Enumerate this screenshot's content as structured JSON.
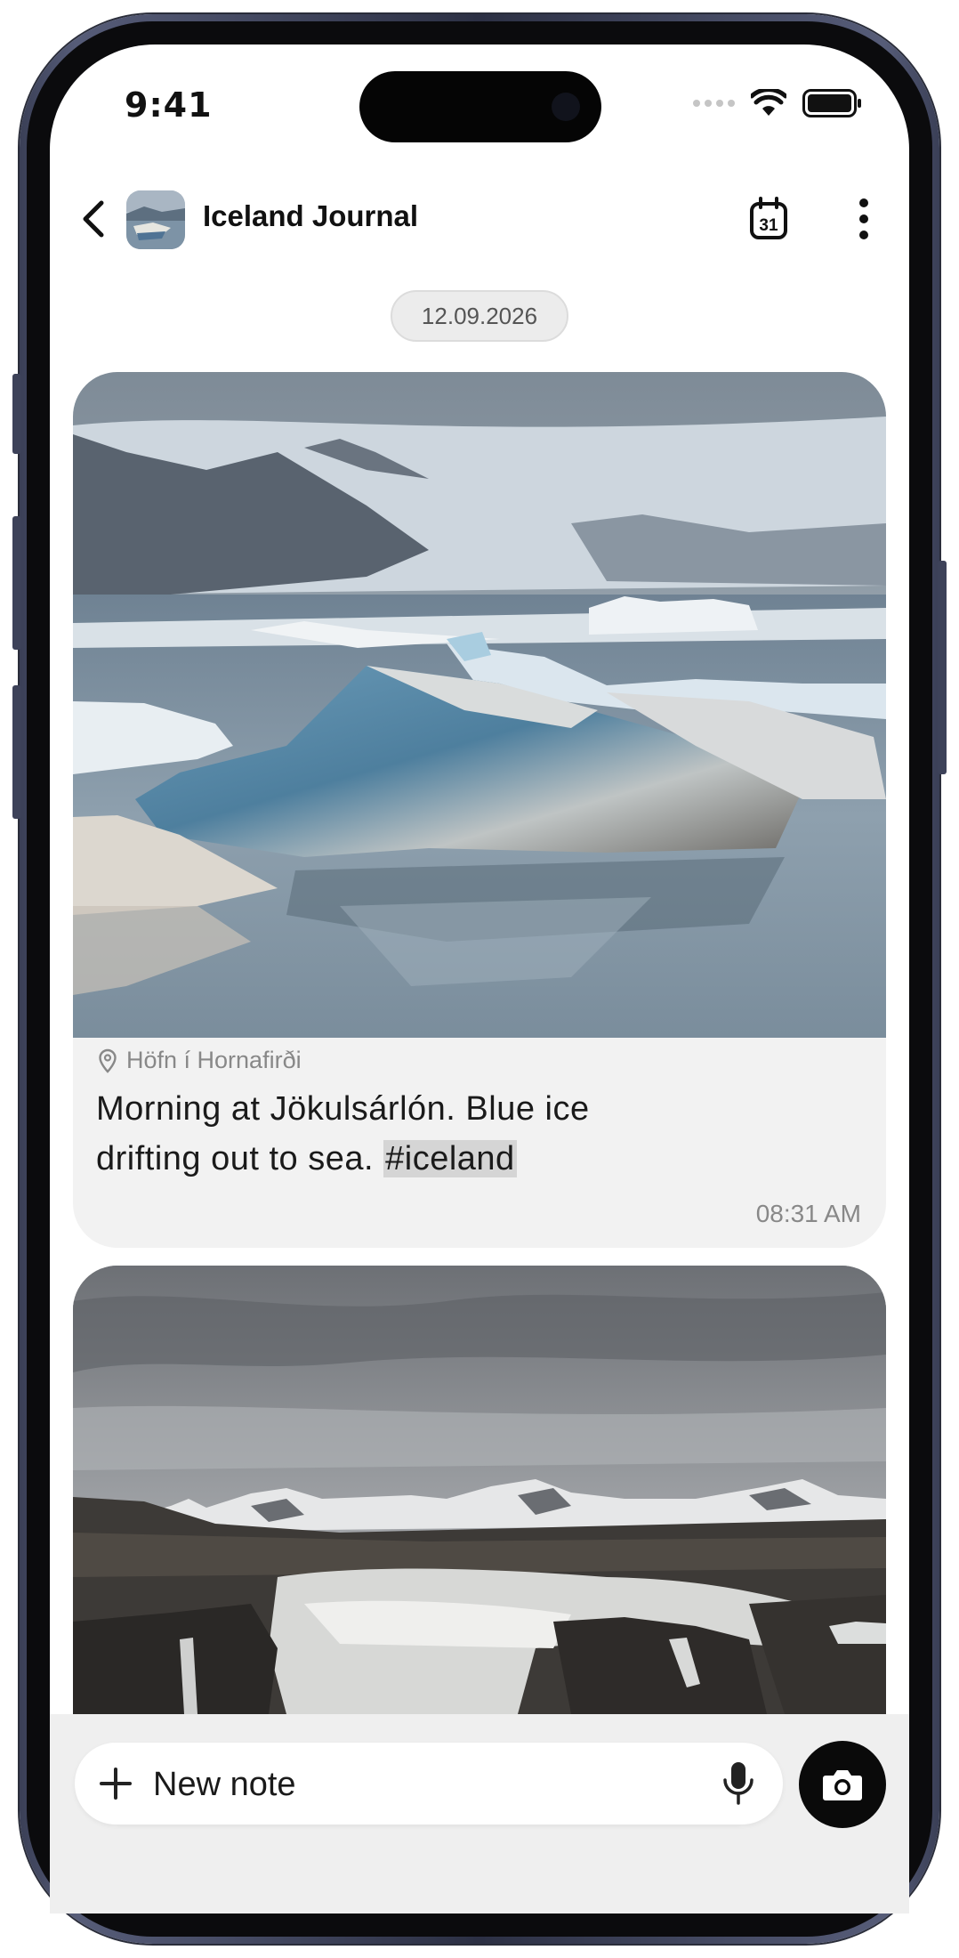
{
  "status_bar": {
    "time": "9:41"
  },
  "header": {
    "title": "Iceland Journal",
    "calendar_day": "31"
  },
  "date_separator": "12.09.2026",
  "messages": [
    {
      "location": "Höfn í Hornafirði",
      "text_before": "Morning at Jökulsárlón. Blue ice drifting out to sea. ",
      "hashtag": "#iceland",
      "time": "08:31 AM"
    }
  ],
  "composer": {
    "placeholder": "New note"
  },
  "icons": {
    "back": "chevron-left-icon",
    "calendar": "calendar-icon",
    "more": "more-vertical-icon",
    "location": "map-pin-icon",
    "plus": "plus-icon",
    "mic": "microphone-icon",
    "camera": "camera-icon"
  },
  "colors": {
    "card_bg": "#f2f2f2",
    "hashtag_bg": "#d5d5d5",
    "camera_button": "#0a0a0a"
  }
}
